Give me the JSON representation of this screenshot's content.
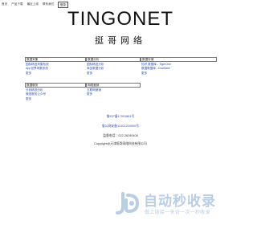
{
  "topbar": {
    "items": [
      "首页",
      "产品下载",
      "最近上线",
      "联系我们"
    ],
    "login_label": "登录"
  },
  "logo": {
    "title": "TINGONET",
    "subtitle": "挺哥网络"
  },
  "sections": [
    {
      "title": "数据采集",
      "items": [
        "国际精选采集系统",
        "App世界采集系统",
        "更多"
      ]
    },
    {
      "title": "数据分析",
      "items": [
        "国际精选分析",
        "商品数据分析",
        "更多"
      ]
    },
    {
      "title": "数据存储",
      "items": [
        "知识 数据库 - TigerOne",
        "数据数据库 - DocBase",
        "更多"
      ]
    },
    {
      "title": "数据服务",
      "items": [
        "分析精选分析",
        "微信服务公众号",
        "更多"
      ]
    },
    {
      "title": "网络营销",
      "items": [
        "互联网营销",
        "更多"
      ]
    }
  ],
  "footer": {
    "icp": "鲁ICP备17001861号",
    "police": "鲁公网安备12101203000号",
    "phone": "监督电话：022-28190408",
    "copyright": "Copyright@天津挺哥网络科技有限公司"
  },
  "watermark": {
    "title": "自动秒收录",
    "tagline": "做上链接一来访一次一秒收录"
  },
  "colors": {
    "link": "#2b4fb0",
    "watermark": "#b8cde6"
  }
}
